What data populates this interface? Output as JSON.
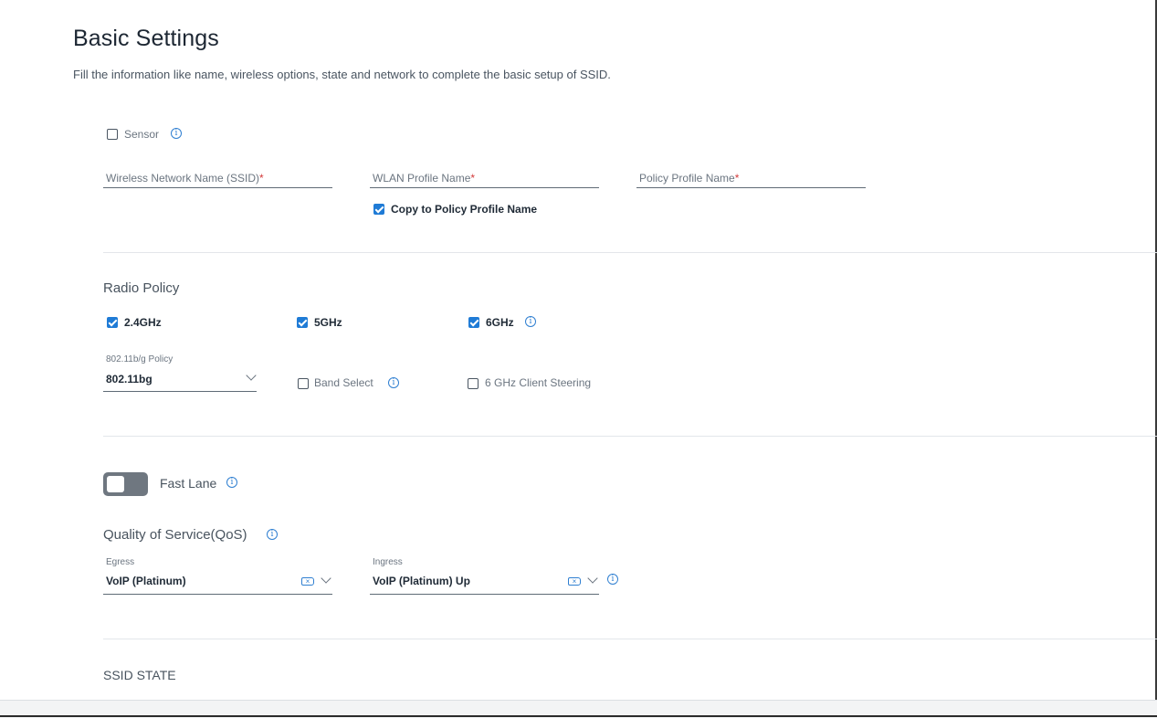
{
  "header": {
    "title": "Basic Settings",
    "subtitle": "Fill the information like name, wireless options, state and network to complete the basic setup of SSID."
  },
  "sensor": {
    "label": "Sensor",
    "checked": false
  },
  "names": {
    "ssid_label": "Wireless Network Name (SSID)",
    "wlan_label": "WLAN Profile Name",
    "policy_label": "Policy Profile Name",
    "required_mark": "*",
    "copy_label": "Copy to Policy Profile Name",
    "copy_checked": true
  },
  "radio_policy": {
    "title": "Radio Policy",
    "bands": [
      {
        "label": "2.4GHz",
        "checked": true
      },
      {
        "label": "5GHz",
        "checked": true
      },
      {
        "label": "6GHz",
        "checked": true
      }
    ],
    "policy_label": "802.11b/g Policy",
    "policy_value": "802.11bg",
    "band_select_label": "Band Select",
    "band_select_checked": false,
    "client_steering_label": "6 GHz Client Steering",
    "client_steering_checked": false
  },
  "fast_lane": {
    "label": "Fast Lane",
    "enabled": false
  },
  "qos": {
    "title": "Quality of Service(QoS)",
    "egress_label": "Egress",
    "egress_value": "VoIP (Platinum)",
    "ingress_label": "Ingress",
    "ingress_value": "VoIP (Platinum) Up"
  },
  "ssid_state": {
    "title": "SSID STATE"
  },
  "colors": {
    "accent": "#1f7bd6",
    "required": "#d33a3a",
    "toggle_off": "#6f7780"
  },
  "icons": {
    "info": "info-icon",
    "chevron": "chevron-down-icon",
    "clear": "clear-icon"
  }
}
